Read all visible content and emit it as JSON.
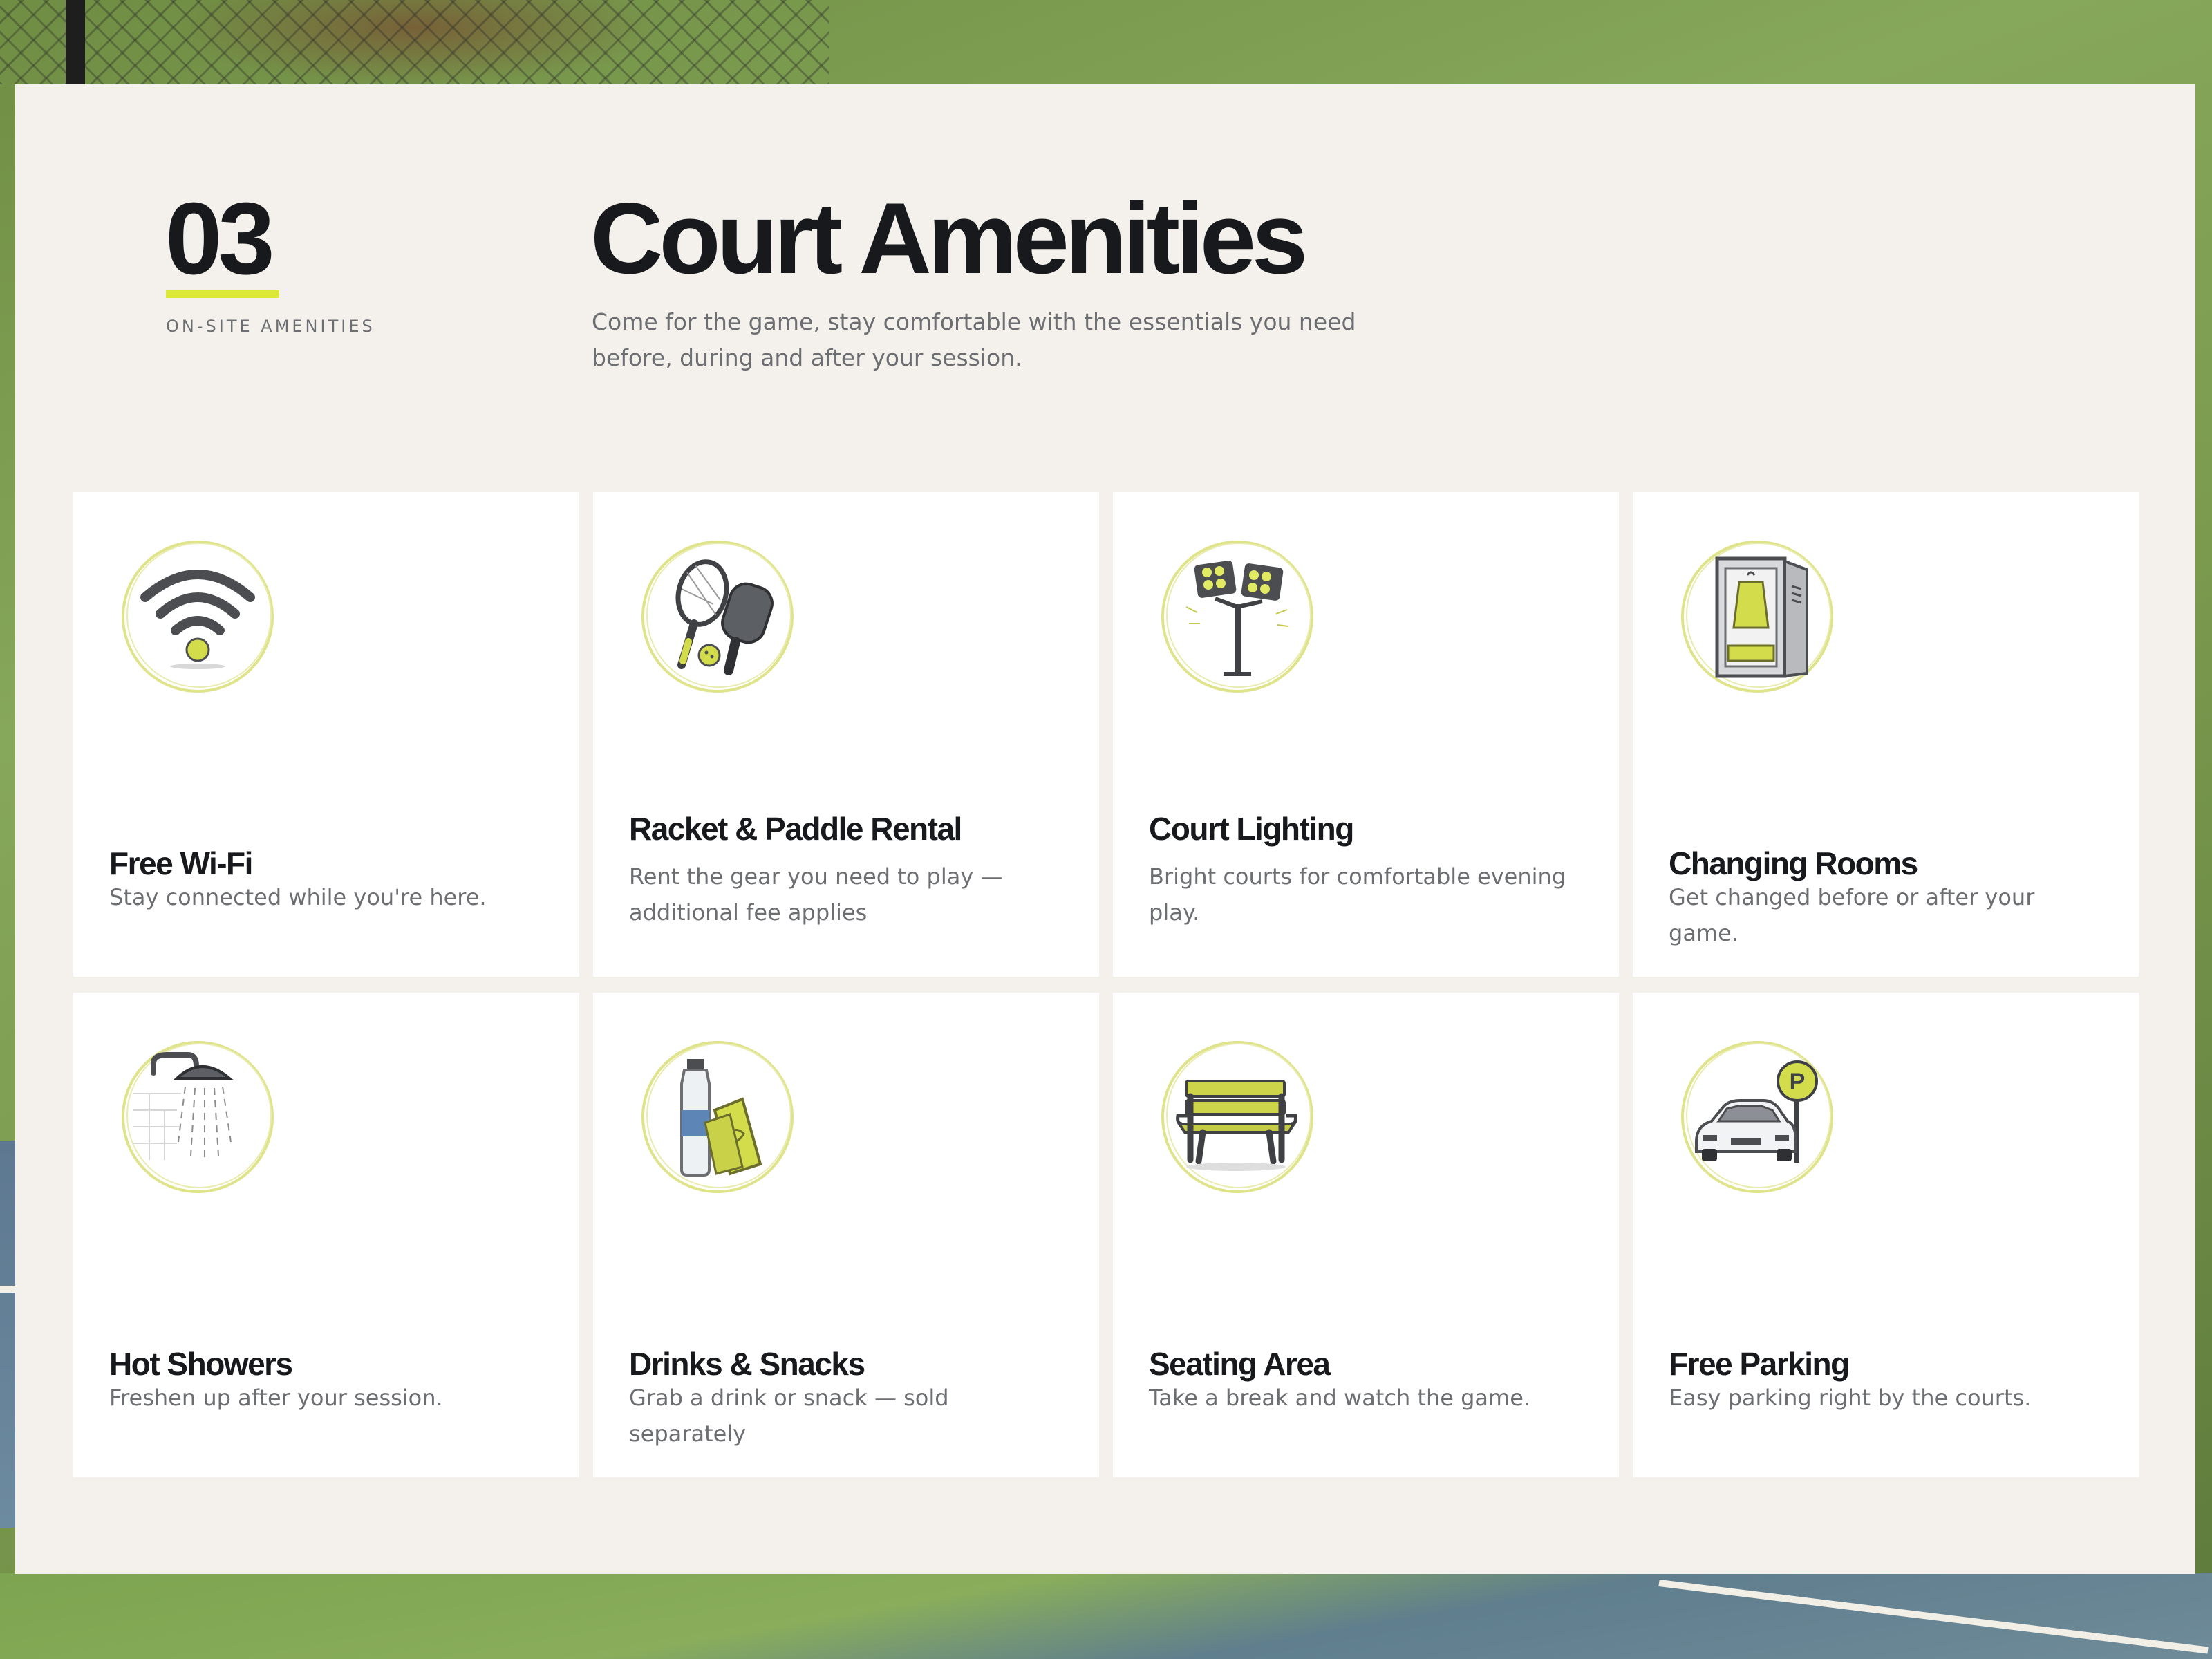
{
  "section": {
    "number": "03",
    "eyebrow": "ON-SITE AMENITIES",
    "title": "Court Amenities",
    "lede": "Come for the game, stay comfortable with the essentials you need before, during and after your session."
  },
  "colors": {
    "accent": "#dbe838",
    "ink": "#17191c",
    "muted": "#6c6e72",
    "panel": "#f4f1ec",
    "card": "#ffffff"
  },
  "amenities": [
    {
      "icon": "wifi-icon",
      "title": "Free Wi-Fi",
      "description": "Stay connected while you're here."
    },
    {
      "icon": "racket-paddle-icon",
      "title": "Racket & Paddle Rental",
      "description": "Rent the gear you need to play — additional fee applies"
    },
    {
      "icon": "floodlight-icon",
      "title": "Court Lighting",
      "description": "Bright courts for comfortable evening play."
    },
    {
      "icon": "locker-icon",
      "title": "Changing Rooms",
      "description": "Get changed before or after your game."
    },
    {
      "icon": "shower-icon",
      "title": "Hot Showers",
      "description": "Freshen up after your session."
    },
    {
      "icon": "drinks-snacks-icon",
      "title": "Drinks & Snacks",
      "description": "Grab a drink or snack — sold separately"
    },
    {
      "icon": "bench-icon",
      "title": "Seating Area",
      "description": "Take a break and watch the game."
    },
    {
      "icon": "car-parking-icon",
      "title": "Free Parking",
      "description": "Easy parking right by the courts."
    }
  ]
}
